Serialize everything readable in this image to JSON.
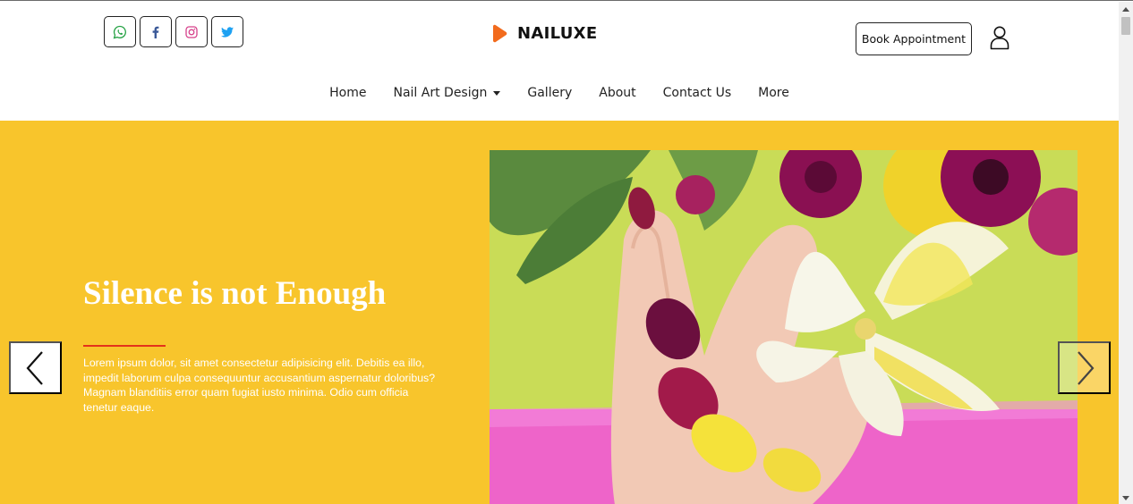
{
  "colors": {
    "hero_background": "#f8c52c",
    "accent_rule": "#e4321b",
    "brand_logo": "#f26b1d",
    "whatsapp": "#25a244",
    "facebook": "#3b5998",
    "instagram": "#d6418b",
    "twitter": "#1da1f2"
  },
  "header": {
    "social_icons": [
      {
        "name": "whatsapp-icon"
      },
      {
        "name": "facebook-icon"
      },
      {
        "name": "instagram-icon"
      },
      {
        "name": "twitter-icon"
      }
    ],
    "brand_name": "NAILUXE",
    "book_button_label": "Book Appointment",
    "user_icon": "user-icon"
  },
  "nav": {
    "items": [
      {
        "label": "Home",
        "has_dropdown": false
      },
      {
        "label": "Nail Art Design",
        "has_dropdown": true
      },
      {
        "label": "Gallery",
        "has_dropdown": false
      },
      {
        "label": "About",
        "has_dropdown": false
      },
      {
        "label": "Contact Us",
        "has_dropdown": false
      },
      {
        "label": "More",
        "has_dropdown": false
      }
    ]
  },
  "hero": {
    "title": "Silence is not Enough",
    "text": "Lorem ipsum dolor, sit amet consectetur adipisicing elit. Debitis ea illo, impedit laborum culpa consequuntur accusantium aspernatur doloribus? Magnam blanditiis error quam fugiat iusto minima. Odio cum officia tenetur eaque.",
    "image_alt": "hand with colorful manicured nails holding a white lily",
    "prev_icon": "chevron-left-icon",
    "next_icon": "chevron-right-icon"
  }
}
